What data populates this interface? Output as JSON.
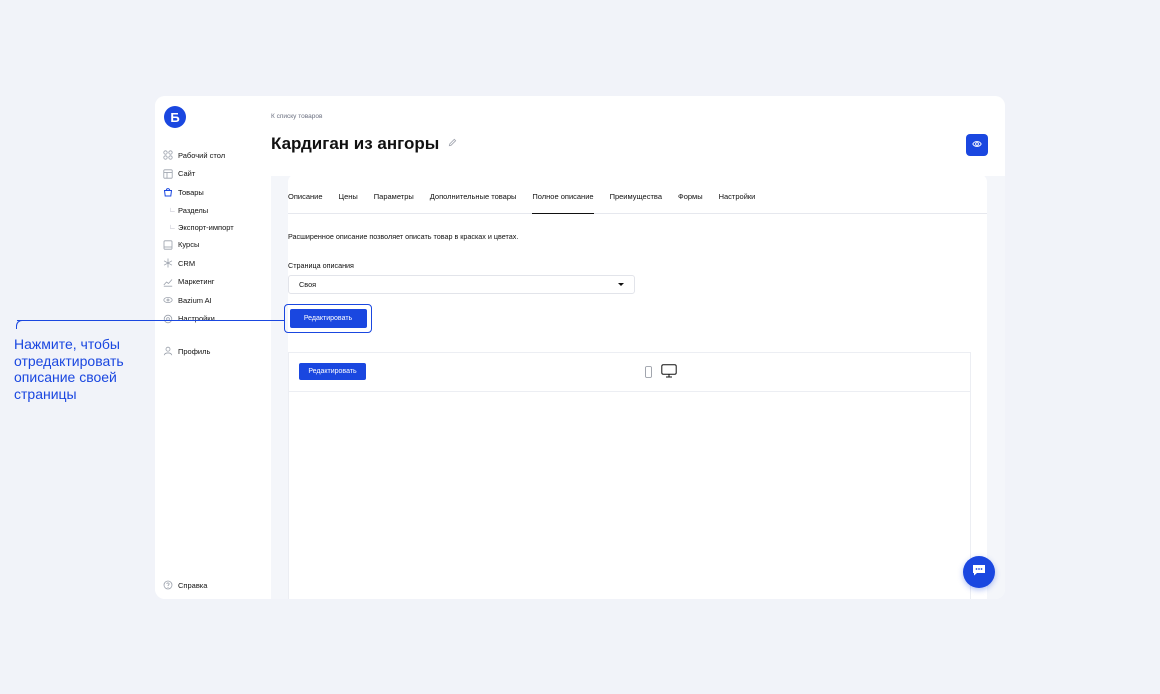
{
  "logo": {
    "letter": "Б"
  },
  "sidebar": {
    "items": [
      {
        "label": "Рабочий стол",
        "icon": "grid-icon"
      },
      {
        "label": "Сайт",
        "icon": "layout-icon"
      },
      {
        "label": "Товары",
        "icon": "basket-icon",
        "active": true
      },
      {
        "label": "Курсы",
        "icon": "book-icon"
      },
      {
        "label": "CRM",
        "icon": "snowflake-icon"
      },
      {
        "label": "Маркетинг",
        "icon": "chart-icon"
      },
      {
        "label": "Bazium AI",
        "icon": "ai-icon"
      },
      {
        "label": "Настройки",
        "icon": "gear-icon"
      },
      {
        "label": "Профиль",
        "icon": "user-icon"
      }
    ],
    "subitems": [
      {
        "label": "Разделы"
      },
      {
        "label": "Экспорт-импорт"
      }
    ],
    "help": "Справка"
  },
  "header": {
    "breadcrumb": "К списку товаров",
    "title": "Кардиган из ангоры"
  },
  "tabs": [
    {
      "label": "Описание"
    },
    {
      "label": "Цены"
    },
    {
      "label": "Параметры"
    },
    {
      "label": "Дополнительные товары"
    },
    {
      "label": "Полное описание",
      "active": true
    },
    {
      "label": "Преимущества"
    },
    {
      "label": "Формы"
    },
    {
      "label": "Настройки"
    }
  ],
  "content": {
    "description": "Расширенное описание позволяет описать товар в красках и цветах.",
    "page_label": "Страница описания",
    "page_value": "Своя",
    "edit_button": "Редактировать",
    "preview_edit_button": "Редактировать"
  },
  "annotation": {
    "text": "Нажмите, чтобы отредактировать описание своей страницы"
  },
  "colors": {
    "accent": "#1a47e0",
    "background": "#f1f3f9"
  }
}
